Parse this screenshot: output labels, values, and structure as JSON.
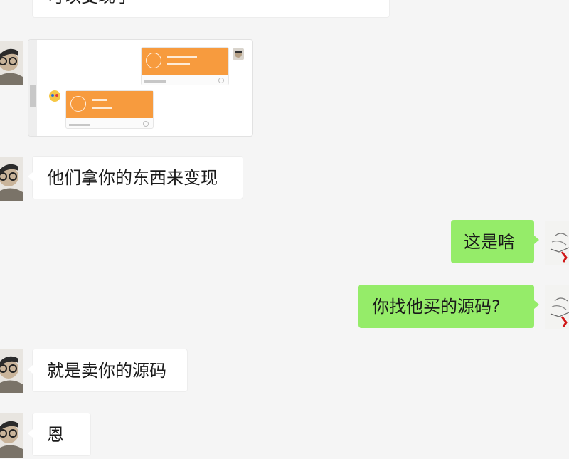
{
  "messages": [
    {
      "side": "left",
      "kind": "text",
      "text": "可以变现了"
    },
    {
      "side": "left",
      "kind": "image"
    },
    {
      "side": "left",
      "kind": "text",
      "text": "他们拿你的东西来变现"
    },
    {
      "side": "right",
      "kind": "text",
      "text": "这是啥"
    },
    {
      "side": "right",
      "kind": "text",
      "text": "你找他买的源码?"
    },
    {
      "side": "left",
      "kind": "text",
      "text": "就是卖你的源码"
    },
    {
      "side": "left",
      "kind": "text",
      "text": "恩"
    }
  ],
  "colors": {
    "background": "#f5f5f5",
    "left_bubble": "#ffffff",
    "right_bubble": "#95ec69",
    "transfer_card": "#f79b3e"
  },
  "icons": [
    "avatar-contact",
    "avatar-self",
    "transfer-icon",
    "check-circle-icon"
  ]
}
